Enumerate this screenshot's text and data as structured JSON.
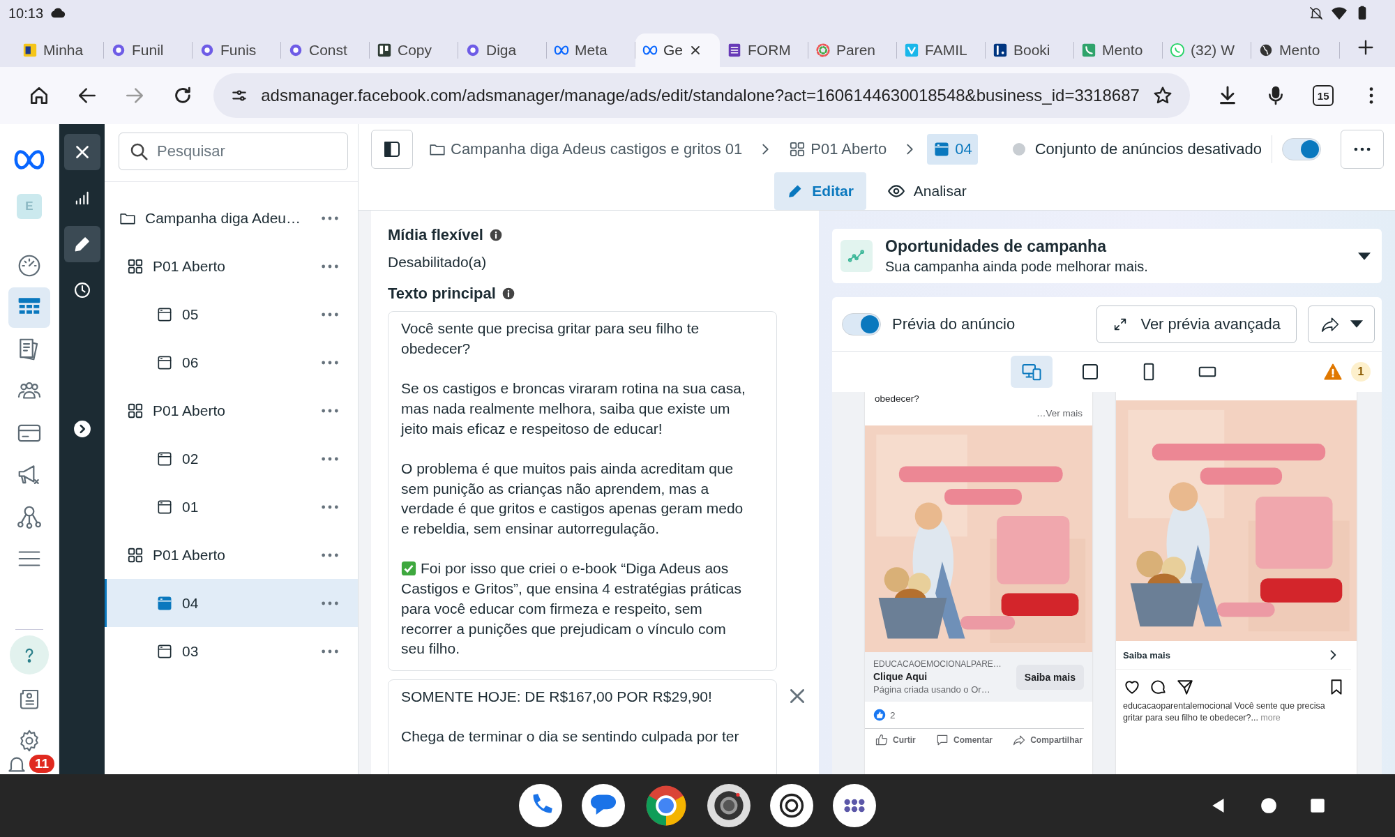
{
  "status_bar": {
    "time": "10:13"
  },
  "browser_tabs": [
    {
      "title": "Minha",
      "kind": "ebook",
      "selected": false
    },
    {
      "title": "Funil",
      "kind": "ring",
      "selected": false
    },
    {
      "title": "Funis",
      "kind": "ring",
      "selected": false
    },
    {
      "title": "Const",
      "kind": "ring",
      "selected": false
    },
    {
      "title": "Copy",
      "kind": "board",
      "selected": false
    },
    {
      "title": "Diga",
      "kind": "ring",
      "selected": false
    },
    {
      "title": "Meta",
      "kind": "infinity",
      "selected": false
    },
    {
      "title": "Ge",
      "kind": "infinity",
      "selected": true
    },
    {
      "title": "FORM",
      "kind": "form",
      "selected": false
    },
    {
      "title": "Paren",
      "kind": "palette",
      "selected": false
    },
    {
      "title": "FAMIL",
      "kind": "bluesquare",
      "selected": false
    },
    {
      "title": "Booki",
      "kind": "navysquare",
      "selected": false
    },
    {
      "title": "Mento",
      "kind": "greensquare",
      "selected": false
    },
    {
      "title": "(32) W",
      "kind": "chatcircle",
      "selected": false
    },
    {
      "title": "Mento",
      "kind": "globe",
      "selected": false
    }
  ],
  "address_bar": {
    "url": "adsmanager.facebook.com/adsmanager/manage/ads/edit/standalone?act=1606144630018548&business_id=3318687",
    "tab_count": "15"
  },
  "app_rail": {
    "account_initial": "E",
    "notification_count": "11",
    "items": [
      {
        "kind": "gauge",
        "selected": false
      },
      {
        "kind": "table",
        "selected": true
      },
      {
        "kind": "pages",
        "selected": false
      },
      {
        "kind": "people",
        "selected": false
      },
      {
        "kind": "card",
        "selected": false
      },
      {
        "kind": "megaphone",
        "selected": false
      },
      {
        "kind": "network",
        "selected": false
      },
      {
        "kind": "menu",
        "selected": false
      }
    ],
    "bottom_items": [
      {
        "kind": "help"
      },
      {
        "kind": "news"
      },
      {
        "kind": "settings"
      }
    ]
  },
  "tool_rail": {
    "items": [
      {
        "kind": "chart",
        "selected": false
      },
      {
        "kind": "edit",
        "selected": true
      },
      {
        "kind": "history",
        "selected": false
      }
    ]
  },
  "tree": {
    "search_placeholder": "Pesquisar",
    "items": [
      {
        "label": "Campanha diga Adeu…",
        "selected": false,
        "children": [
          {
            "label": "P01 Aberto",
            "selected": false,
            "children": [
              {
                "label": "05",
                "selected": false
              },
              {
                "label": "06",
                "selected": false
              }
            ]
          },
          {
            "label": "P01 Aberto",
            "selected": false,
            "children": [
              {
                "label": "02",
                "selected": false
              },
              {
                "label": "01",
                "selected": false
              }
            ]
          },
          {
            "label": "P01 Aberto",
            "selected": false,
            "children": [
              {
                "label": "04",
                "selected": true
              },
              {
                "label": "03",
                "selected": false
              }
            ]
          }
        ]
      }
    ]
  },
  "header": {
    "breadcrumbs": [
      {
        "kind": "campaign",
        "label": "Campanha diga Adeus castigos e gritos 01",
        "selected": false
      },
      {
        "kind": "adset",
        "label": "P01 Aberto",
        "selected": false
      },
      {
        "kind": "ad",
        "label": "04",
        "selected": true
      }
    ],
    "status": "Conjunto de anúncios desativado",
    "on": true,
    "modes": [
      {
        "kind": "edit",
        "label": "Editar",
        "selected": true
      },
      {
        "kind": "view",
        "label": "Analisar",
        "selected": false
      }
    ]
  },
  "editor": {
    "sections": [
      {
        "title": "Mídia flexível",
        "value": "Desabilitado(a)"
      },
      {
        "title": "Texto principal",
        "text_boxes": [
          {
            "removable": false,
            "paragraphs": [
              {
                "check_mark": false,
                "text": "Você sente que precisa gritar para seu filho te obedecer?"
              },
              {
                "check_mark": false,
                "text": "Se os castigos e broncas viraram rotina na sua casa, mas nada realmente melhora, saiba que existe um jeito mais eficaz e respeitoso de educar!"
              },
              {
                "check_mark": false,
                "text": "O problema é que muitos pais ainda acreditam que sem punição as crianças não aprendem, mas a verdade é que gritos e castigos apenas geram medo e rebeldia, sem ensinar autorregulação."
              },
              {
                "check_mark": true,
                "text": "Foi por isso que criei o e-book “Diga Adeus aos Castigos e Gritos”, que ensina 4 estratégias práticas para você educar com firmeza e respeito, sem recorrer a punições que prejudicam o vínculo com seu filho."
              }
            ]
          },
          {
            "removable": true,
            "paragraphs": [
              {
                "check_mark": false,
                "text": "SOMENTE HOJE: DE R$167,00 POR R$29,90!"
              },
              {
                "check_mark": false,
                "text": "Chega de terminar o dia se sentindo culpada por ter"
              }
            ]
          }
        ]
      }
    ]
  },
  "opportunities": {
    "title": "Oportunidades de campanha",
    "subtitle": "Sua campanha ainda pode melhorar mais.",
    "expanded": false
  },
  "preview": {
    "toggle_label": "Prévia do anúncio",
    "on": true,
    "advanced_button": "Ver prévia avançada",
    "warning_count": "1",
    "devices": [
      {
        "kind": "multi",
        "selected": true
      },
      {
        "kind": "square",
        "selected": false
      },
      {
        "kind": "phone",
        "selected": false
      },
      {
        "kind": "landscape",
        "selected": false
      }
    ],
    "facebook": {
      "text": "obedecer?",
      "more": "…Ver mais",
      "domain": "EDUCACAOEMOCIONALPARE…",
      "headline": "Clique Aqui",
      "description": "Página criada usando o Or…",
      "cta": "Saiba mais",
      "reactions": "2",
      "actions": [
        {
          "kind": "like",
          "label": "Curtir"
        },
        {
          "kind": "comment",
          "label": "Comentar"
        },
        {
          "kind": "share",
          "label": "Compartilhar"
        }
      ]
    },
    "instagram": {
      "cta": "Saiba mais",
      "caption": "educacaoparentalemocional Você sente que precisa gritar para seu filho te obedecer?...",
      "more": "more"
    }
  }
}
